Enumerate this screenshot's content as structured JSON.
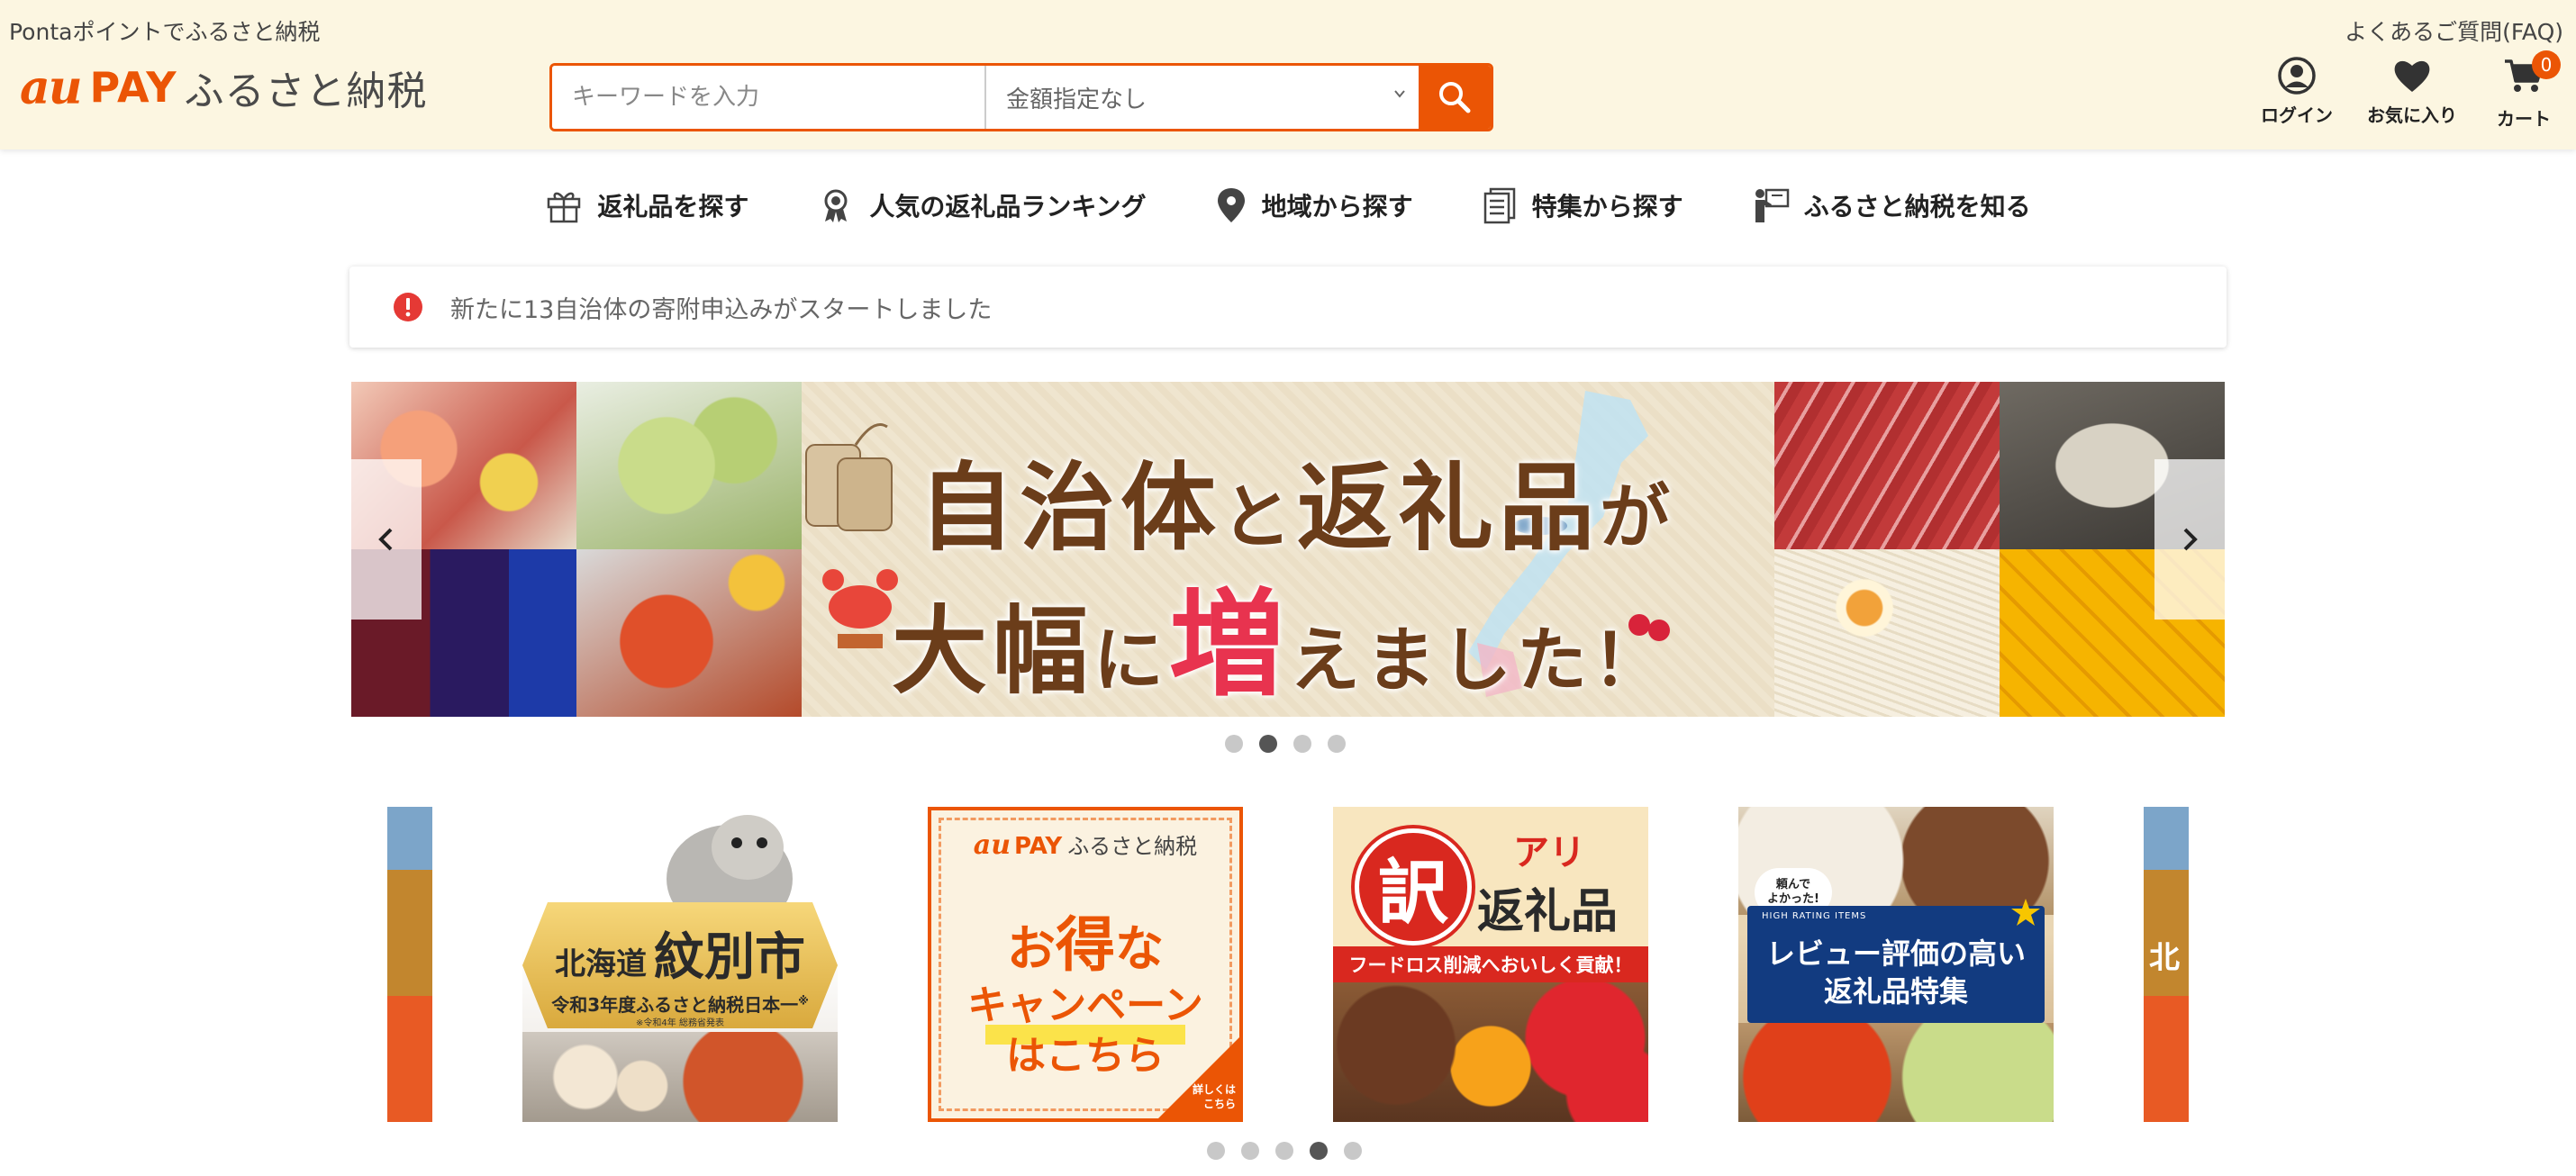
{
  "header": {
    "top_note": "Pontaポイントでふるさと納税",
    "faq": "よくあるご質問(FAQ)",
    "logo": {
      "au": "au",
      "pay": "PAY",
      "furusato": "ふるさと納税"
    },
    "search": {
      "placeholder": "キーワードを入力",
      "amount_selected": "金額指定なし"
    },
    "icons": {
      "login": "ログイン",
      "favorites": "お気に入り",
      "cart": "カート",
      "cart_count": "0"
    },
    "accent_color": "#eb5505"
  },
  "nav": {
    "items": [
      {
        "label": "返礼品を探す",
        "icon": "gift-icon"
      },
      {
        "label": "人気の返礼品ランキング",
        "icon": "medal-icon"
      },
      {
        "label": "地域から探す",
        "icon": "map-pin-icon"
      },
      {
        "label": "特集から探す",
        "icon": "document-icon"
      },
      {
        "label": "ふるさと納税を知る",
        "icon": "presenter-icon"
      }
    ]
  },
  "notice": {
    "text": "新たに13自治体の寄附申込みがスタートしました",
    "icon": "alert-icon",
    "color": "#e53935"
  },
  "hero": {
    "line1_a": "自治体",
    "line1_b": "と",
    "line1_c": "返礼品",
    "line1_d": "が",
    "line2_a": "大幅",
    "line2_b": "に",
    "line2_c": "増",
    "line2_d": "えました！",
    "dots_total": 4,
    "dots_active": 2
  },
  "cards": {
    "monbetsu": {
      "area": "北海道",
      "city": "紋別市",
      "sub": "令和3年度ふるさと納税日本一",
      "sub_mark": "※",
      "note": "※令和4年 総務省発表"
    },
    "campaign": {
      "logo_au": "au",
      "logo_pay": "PAY",
      "logo_text": "ふるさと納税",
      "line1_a": "お",
      "line1_b": "得",
      "line1_c": "な",
      "line2": "キャンペーン",
      "line3": "はこちら",
      "corner_a": "詳しくは",
      "corner_b": "こちら"
    },
    "wakeari": {
      "kanji": "訳",
      "ari": "アリ",
      "title": "返礼品",
      "ribbon": "フードロス削減へおいしく貢献！"
    },
    "review": {
      "bubble_a": "頼んで",
      "bubble_b": "よかった!",
      "small": "HIGH RATING ITEMS",
      "line1": "レビュー評価の高い",
      "line2": "返礼品特集"
    },
    "partial_text": "北",
    "dots_total": 5,
    "dots_active": 4
  }
}
